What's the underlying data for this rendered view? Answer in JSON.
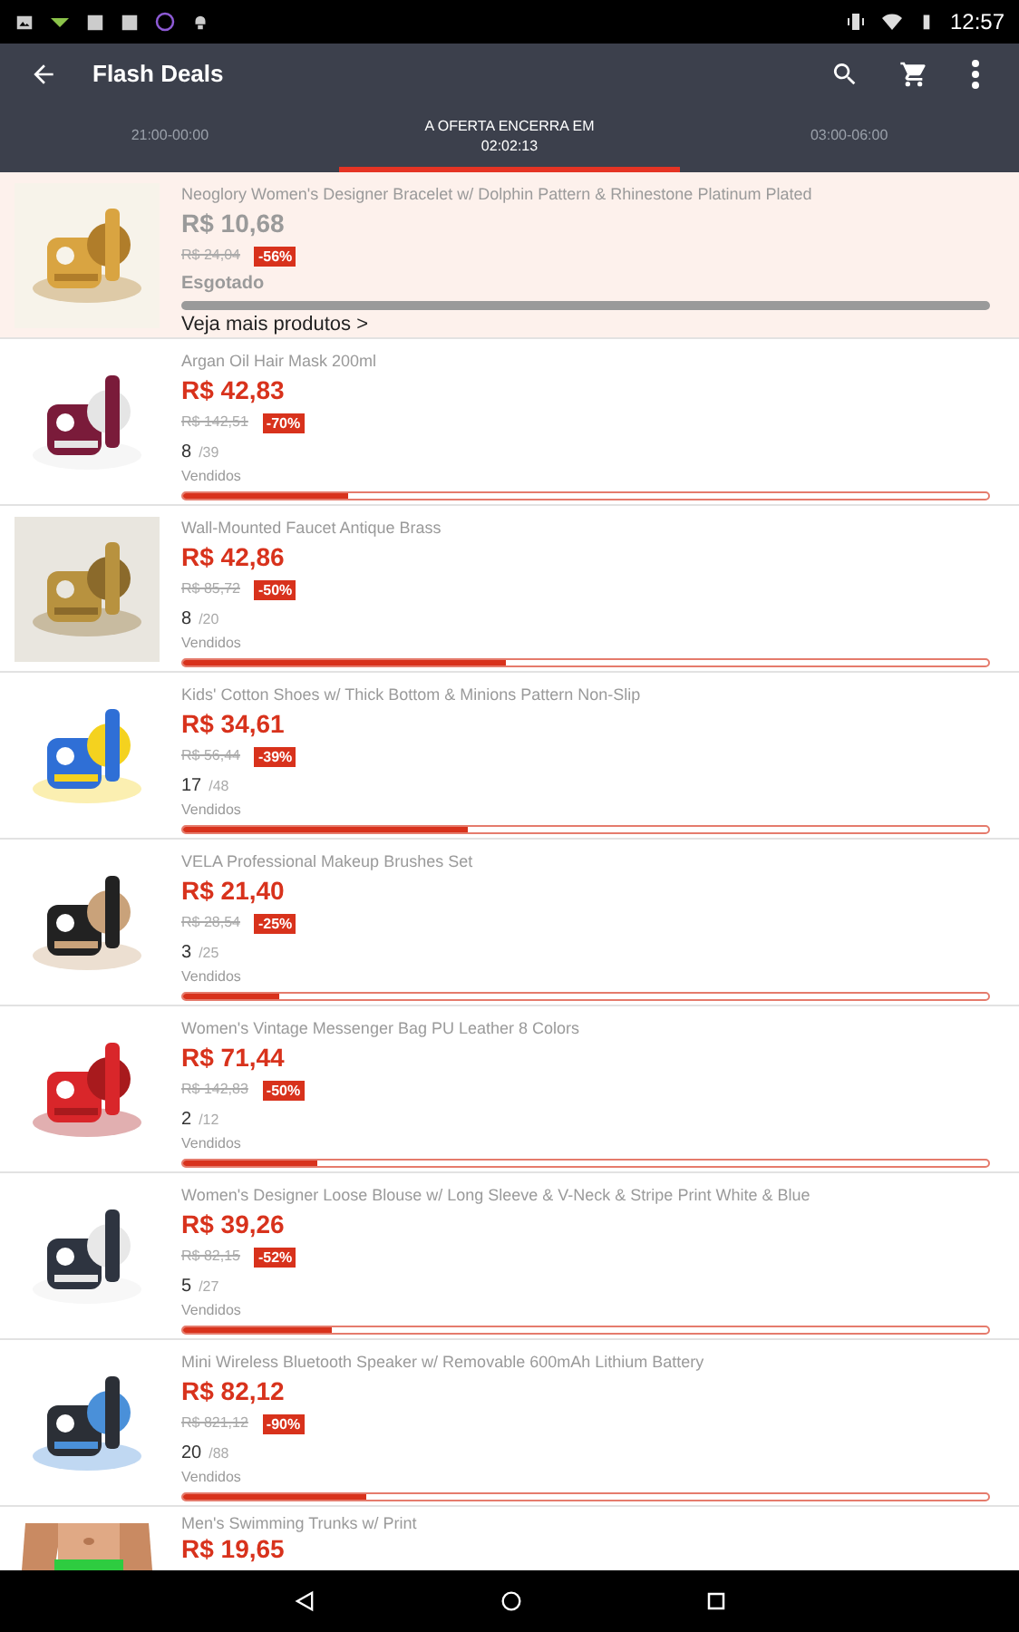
{
  "status_bar": {
    "time": "12:57"
  },
  "app_bar": {
    "title": "Flash Deals"
  },
  "tabs": [
    {
      "label": "21:00-00:00",
      "selected": false
    },
    {
      "label": "A OFERTA ENCERRA EM",
      "countdown": "02:02:13",
      "selected": true
    },
    {
      "label": "03:00-06:00",
      "selected": false
    }
  ],
  "products": [
    {
      "kind": "sold_out",
      "name": "Neoglory Women's Designer Bracelet w/ Dolphin Pattern & Rhinestone Platinum Plated",
      "price": "R$ 10,68",
      "old_price": "R$ 24,04",
      "discount": "-56%",
      "status": "Esgotado",
      "link": "Veja mais produtos >"
    },
    {
      "kind": "selling",
      "name": "Argan Oil Hair Mask 200ml",
      "price": "R$ 42,83",
      "old_price": "R$ 142,51",
      "discount": "-70%",
      "sold": "8",
      "total": "/39",
      "sold_label": "Vendidos",
      "level": 0.205
    },
    {
      "kind": "selling",
      "name": "Wall-Mounted Faucet Antique Brass",
      "price": "R$ 42,86",
      "old_price": "R$ 85,72",
      "discount": "-50%",
      "sold": "8",
      "total": "/20",
      "sold_label": "Vendidos",
      "level": 0.4
    },
    {
      "kind": "selling",
      "name": "Kids' Cotton Shoes w/ Thick Bottom & Minions Pattern Non-Slip",
      "price": "R$ 34,61",
      "old_price": "R$ 56,44",
      "discount": "-39%",
      "sold": "17",
      "total": "/48",
      "sold_label": "Vendidos",
      "level": 0.354
    },
    {
      "kind": "selling",
      "name": "VELA Professional Makeup Brushes Set",
      "price": "R$ 21,40",
      "old_price": "R$ 28,54",
      "discount": "-25%",
      "sold": "3",
      "total": "/25",
      "sold_label": "Vendidos",
      "level": 0.12
    },
    {
      "kind": "selling",
      "name": "Women's Vintage Messenger Bag PU Leather 8 Colors",
      "price": "R$ 71,44",
      "old_price": "R$ 142,83",
      "discount": "-50%",
      "sold": "2",
      "total": "/12",
      "sold_label": "Vendidos",
      "level": 0.167
    },
    {
      "kind": "selling",
      "name": "Women's Designer Loose Blouse w/ Long Sleeve & V-Neck & Stripe Print White & Blue",
      "price": "R$ 39,26",
      "old_price": "R$ 82,15",
      "discount": "-52%",
      "sold": "5",
      "total": "/27",
      "sold_label": "Vendidos",
      "level": 0.185
    },
    {
      "kind": "selling",
      "name": "Mini Wireless Bluetooth Speaker w/ Removable 600mAh Lithium Battery",
      "price": "R$ 82,12",
      "old_price": "R$ 821,12",
      "discount": "-90%",
      "sold": "20",
      "total": "/88",
      "sold_label": "Vendidos",
      "level": 0.227
    },
    {
      "kind": "partial",
      "name": "Men's Swimming Trunks w/ Print",
      "price": "R$ 19,65"
    }
  ]
}
